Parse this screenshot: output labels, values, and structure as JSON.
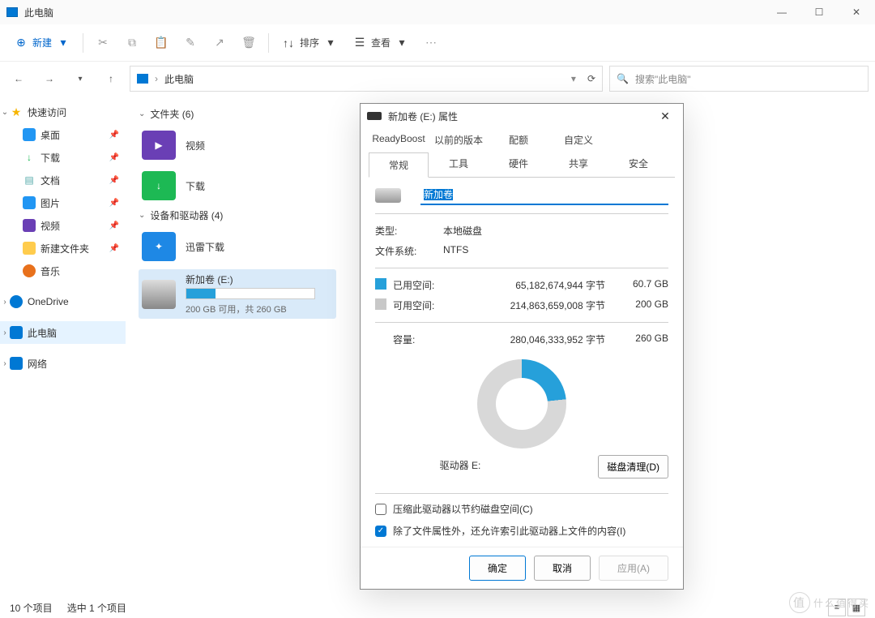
{
  "window": {
    "title": "此电脑"
  },
  "toolbar": {
    "new": "新建",
    "sort": "排序",
    "view": "查看"
  },
  "path": {
    "crumb_label": "此电脑"
  },
  "search": {
    "placeholder": "搜索\"此电脑\""
  },
  "sidebar": {
    "quick_access": "快速访问",
    "items": [
      {
        "label": "桌面"
      },
      {
        "label": "下载"
      },
      {
        "label": "文档"
      },
      {
        "label": "图片"
      },
      {
        "label": "视频"
      },
      {
        "label": "新建文件夹"
      },
      {
        "label": "音乐"
      }
    ],
    "onedrive": "OneDrive",
    "this_pc": "此电脑",
    "network": "网络"
  },
  "groups": {
    "folders_header": "文件夹 (6)",
    "drives_header": "设备和驱动器 (4)"
  },
  "items": {
    "video": "视频",
    "downloads": "下载",
    "xunlei": "迅雷下载",
    "drive_e": {
      "name": "新加卷 (E:)",
      "sub": "200 GB 可用，共 260 GB"
    }
  },
  "status": {
    "count": "10 个项目",
    "sel": "选中 1 个项目"
  },
  "dialog": {
    "title": "新加卷 (E:) 属性",
    "tabs_row1": [
      "ReadyBoost",
      "以前的版本",
      "配额",
      "自定义"
    ],
    "tabs_row2": [
      "常规",
      "工具",
      "硬件",
      "共享",
      "安全"
    ],
    "active_tab": 0,
    "name_value": "新加卷",
    "type_label": "类型:",
    "type_value": "本地磁盘",
    "fs_label": "文件系统:",
    "fs_value": "NTFS",
    "used_label": "已用空间:",
    "used_bytes": "65,182,674,944 字节",
    "used_gb": "60.7 GB",
    "free_label": "可用空间:",
    "free_bytes": "214,863,659,008 字节",
    "free_gb": "200 GB",
    "cap_label": "容量:",
    "cap_bytes": "280,046,333,952 字节",
    "cap_gb": "260 GB",
    "drive_label": "驱动器 E:",
    "clean_btn": "磁盘清理(D)",
    "chk_compress": "压缩此驱动器以节约磁盘空间(C)",
    "chk_index": "除了文件属性外，还允许索引此驱动器上文件的内容(I)",
    "btn_ok": "确定",
    "btn_cancel": "取消",
    "btn_apply": "应用(A)"
  },
  "chart_data": {
    "type": "pie",
    "title": "驱动器 E:",
    "series": [
      {
        "name": "已用空间",
        "value": 60.7,
        "unit": "GB",
        "color": "#26a0da"
      },
      {
        "name": "可用空间",
        "value": 200,
        "unit": "GB",
        "color": "#d8d8d8"
      }
    ],
    "total": {
      "label": "容量",
      "value": 260,
      "unit": "GB"
    }
  },
  "watermark": "什么值得买"
}
